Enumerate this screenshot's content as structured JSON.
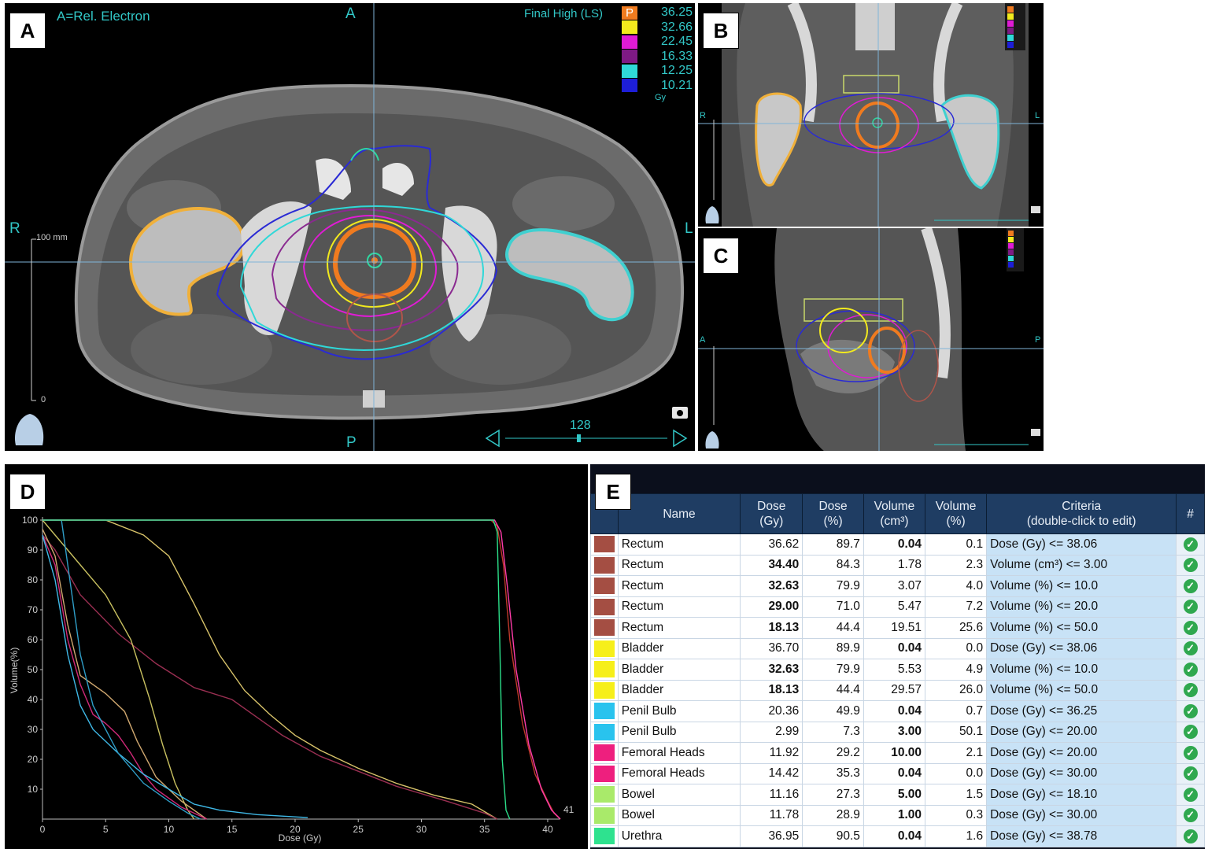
{
  "panels": {
    "a": {
      "label": "A",
      "title": "A=Rel. Electron",
      "orient": {
        "top": "A",
        "bottom": "P",
        "left": "R",
        "right": "L"
      },
      "scale_top": "100 mm",
      "scale_bottom": "0",
      "slice": "128",
      "legend_title": "Final High (LS)",
      "legend_unit": "Gy",
      "legend_badge": "P",
      "legend": [
        {
          "value": "36.25",
          "color": "#f07b1f"
        },
        {
          "value": "32.66",
          "color": "#f2ea1d"
        },
        {
          "value": "22.45",
          "color": "#e01bd5"
        },
        {
          "value": "16.33",
          "color": "#7e1a84"
        },
        {
          "value": "12.25",
          "color": "#2fd8d8"
        },
        {
          "value": "10.21",
          "color": "#1d1ed8"
        }
      ]
    },
    "b": {
      "label": "B",
      "orient_left": "R",
      "orient_right": "L"
    },
    "c": {
      "label": "C",
      "orient_left": "A",
      "orient_right": "P"
    },
    "d": {
      "label": "D"
    },
    "e": {
      "label": "E"
    }
  },
  "chart_data": {
    "type": "line",
    "xlabel": "Dose (Gy)",
    "ylabel": "Volume(%)",
    "xlim": [
      0,
      41
    ],
    "ylim": [
      0,
      100
    ],
    "x_ticks": [
      0,
      5,
      10,
      15,
      20,
      25,
      30,
      35,
      40
    ],
    "y_ticks": [
      10,
      20,
      30,
      40,
      50,
      60,
      70,
      80,
      90,
      100
    ],
    "annotation": "41",
    "series": [
      {
        "color": "#d8c36a",
        "points": [
          [
            0,
            100
          ],
          [
            5,
            100
          ],
          [
            8,
            95
          ],
          [
            10,
            88
          ],
          [
            12,
            72
          ],
          [
            14,
            55
          ],
          [
            16,
            43
          ],
          [
            18,
            35
          ],
          [
            20,
            28
          ],
          [
            22,
            23
          ],
          [
            25,
            17
          ],
          [
            28,
            12
          ],
          [
            31,
            8
          ],
          [
            34,
            5
          ],
          [
            36,
            0
          ]
        ]
      },
      {
        "color": "#9a2f52",
        "points": [
          [
            0,
            95
          ],
          [
            1,
            90
          ],
          [
            3,
            75
          ],
          [
            6,
            62
          ],
          [
            9,
            52
          ],
          [
            12,
            44
          ],
          [
            15,
            40
          ],
          [
            17,
            34
          ],
          [
            19,
            28
          ],
          [
            22,
            21
          ],
          [
            25,
            16
          ],
          [
            28,
            11
          ],
          [
            32,
            6
          ],
          [
            35,
            2
          ],
          [
            36,
            0
          ]
        ]
      },
      {
        "color": "#c8c060",
        "points": [
          [
            0,
            100
          ],
          [
            1,
            95
          ],
          [
            3,
            85
          ],
          [
            5,
            75
          ],
          [
            7,
            60
          ],
          [
            8.5,
            40
          ],
          [
            9.5,
            25
          ],
          [
            10.5,
            12
          ],
          [
            11.5,
            3
          ],
          [
            12,
            0
          ]
        ]
      },
      {
        "color": "#d0a870",
        "points": [
          [
            0,
            97
          ],
          [
            1,
            88
          ],
          [
            2,
            65
          ],
          [
            3,
            48
          ],
          [
            5,
            42
          ],
          [
            6.5,
            36
          ],
          [
            7.5,
            26
          ],
          [
            9,
            14
          ],
          [
            11,
            6
          ],
          [
            13,
            0
          ]
        ]
      },
      {
        "color": "#d02878",
        "points": [
          [
            0,
            95
          ],
          [
            1,
            85
          ],
          [
            2,
            60
          ],
          [
            3,
            45
          ],
          [
            4,
            35
          ],
          [
            5,
            32
          ],
          [
            6,
            28
          ],
          [
            7,
            22
          ],
          [
            8,
            15
          ],
          [
            9,
            10
          ],
          [
            11,
            4
          ],
          [
            13,
            0
          ]
        ]
      },
      {
        "color": "#3fb8e6",
        "points": [
          [
            0,
            95
          ],
          [
            1,
            80
          ],
          [
            2,
            55
          ],
          [
            3,
            38
          ],
          [
            4,
            30
          ],
          [
            6,
            22
          ],
          [
            8,
            15
          ],
          [
            10,
            10
          ],
          [
            12,
            5
          ],
          [
            14,
            3
          ],
          [
            17,
            1.5
          ],
          [
            21,
            0.5
          ]
        ]
      },
      {
        "color": "#2f9ec8",
        "points": [
          [
            0,
            100
          ],
          [
            1.5,
            100
          ],
          [
            2,
            85
          ],
          [
            3,
            55
          ],
          [
            4,
            38
          ],
          [
            6,
            22
          ],
          [
            8,
            12
          ],
          [
            10,
            6
          ],
          [
            11.5,
            2
          ],
          [
            12.5,
            0
          ]
        ]
      },
      {
        "color": "#c0392b",
        "points": [
          [
            0,
            100
          ],
          [
            35.5,
            100
          ],
          [
            36,
            98
          ],
          [
            36.5,
            85
          ],
          [
            37,
            60
          ],
          [
            38,
            32
          ],
          [
            39,
            15
          ],
          [
            40,
            6
          ],
          [
            40.5,
            2
          ],
          [
            41,
            0
          ]
        ]
      },
      {
        "color": "#ff3caa",
        "points": [
          [
            0,
            100
          ],
          [
            35.8,
            100
          ],
          [
            36.3,
            96
          ],
          [
            36.8,
            78
          ],
          [
            37.5,
            50
          ],
          [
            38.5,
            25
          ],
          [
            39.5,
            10
          ],
          [
            40.3,
            3
          ],
          [
            41,
            0
          ]
        ]
      },
      {
        "color": "#2ce08a",
        "points": [
          [
            0,
            100
          ],
          [
            35.7,
            100
          ],
          [
            36,
            96
          ],
          [
            36.2,
            60
          ],
          [
            36.4,
            20
          ],
          [
            36.7,
            3
          ],
          [
            37,
            0
          ]
        ]
      }
    ]
  },
  "table": {
    "headers": [
      "Name",
      "Dose\n(Gy)",
      "Dose\n(%)",
      "Volume\n(cm³)",
      "Volume\n(%)",
      "Criteria\n(double-click to edit)",
      "#"
    ],
    "rows": [
      {
        "color": "#a44e43",
        "name": "Rectum",
        "dose_gy": "36.62",
        "dose_pct": "89.7",
        "vol_cm3": "0.04",
        "vol_pct": "0.1",
        "criteria": "Dose (Gy) <= 38.06",
        "bold": "vol_cm3"
      },
      {
        "color": "#a44e43",
        "name": "Rectum",
        "dose_gy": "34.40",
        "dose_pct": "84.3",
        "vol_cm3": "1.78",
        "vol_pct": "2.3",
        "criteria": "Volume (cm³) <= 3.00",
        "bold": "dose_gy"
      },
      {
        "color": "#a44e43",
        "name": "Rectum",
        "dose_gy": "32.63",
        "dose_pct": "79.9",
        "vol_cm3": "3.07",
        "vol_pct": "4.0",
        "criteria": "Volume (%) <= 10.0",
        "bold": "dose_gy"
      },
      {
        "color": "#a44e43",
        "name": "Rectum",
        "dose_gy": "29.00",
        "dose_pct": "71.0",
        "vol_cm3": "5.47",
        "vol_pct": "7.2",
        "criteria": "Volume (%) <= 20.0",
        "bold": "dose_gy"
      },
      {
        "color": "#a44e43",
        "name": "Rectum",
        "dose_gy": "18.13",
        "dose_pct": "44.4",
        "vol_cm3": "19.51",
        "vol_pct": "25.6",
        "criteria": "Volume (%) <= 50.0",
        "bold": "dose_gy"
      },
      {
        "color": "#f6ef1a",
        "name": "Bladder",
        "dose_gy": "36.70",
        "dose_pct": "89.9",
        "vol_cm3": "0.04",
        "vol_pct": "0.0",
        "criteria": "Dose (Gy) <= 38.06",
        "bold": "vol_cm3"
      },
      {
        "color": "#f6ef1a",
        "name": "Bladder",
        "dose_gy": "32.63",
        "dose_pct": "79.9",
        "vol_cm3": "5.53",
        "vol_pct": "4.9",
        "criteria": "Volume (%) <= 10.0",
        "bold": "dose_gy"
      },
      {
        "color": "#f6ef1a",
        "name": "Bladder",
        "dose_gy": "18.13",
        "dose_pct": "44.4",
        "vol_cm3": "29.57",
        "vol_pct": "26.0",
        "criteria": "Volume (%) <= 50.0",
        "bold": "dose_gy"
      },
      {
        "color": "#29c3ee",
        "name": "Penil Bulb",
        "dose_gy": "20.36",
        "dose_pct": "49.9",
        "vol_cm3": "0.04",
        "vol_pct": "0.7",
        "criteria": "Dose (Gy) <= 36.25",
        "bold": "vol_cm3"
      },
      {
        "color": "#29c3ee",
        "name": "Penil Bulb",
        "dose_gy": "2.99",
        "dose_pct": "7.3",
        "vol_cm3": "3.00",
        "vol_pct": "50.1",
        "criteria": "Dose (Gy) <= 20.00",
        "bold": "vol_cm3"
      },
      {
        "color": "#ee1f7e",
        "name": "Femoral  Heads",
        "dose_gy": "11.92",
        "dose_pct": "29.2",
        "vol_cm3": "10.00",
        "vol_pct": "2.1",
        "criteria": "Dose (Gy) <= 20.00",
        "bold": "vol_cm3"
      },
      {
        "color": "#ee1f7e",
        "name": "Femoral  Heads",
        "dose_gy": "14.42",
        "dose_pct": "35.3",
        "vol_cm3": "0.04",
        "vol_pct": "0.0",
        "criteria": "Dose (Gy) <= 30.00",
        "bold": "vol_cm3"
      },
      {
        "color": "#a9ea6a",
        "name": "Bowel",
        "dose_gy": "11.16",
        "dose_pct": "27.3",
        "vol_cm3": "5.00",
        "vol_pct": "1.5",
        "criteria": "Dose (Gy) <= 18.10",
        "bold": "vol_cm3"
      },
      {
        "color": "#a9ea6a",
        "name": "Bowel",
        "dose_gy": "11.78",
        "dose_pct": "28.9",
        "vol_cm3": "1.00",
        "vol_pct": "0.3",
        "criteria": "Dose (Gy) <= 30.00",
        "bold": "vol_cm3"
      },
      {
        "color": "#2ee28f",
        "name": "Urethra",
        "dose_gy": "36.95",
        "dose_pct": "90.5",
        "vol_cm3": "0.04",
        "vol_pct": "1.6",
        "criteria": "Dose (Gy) <= 38.78",
        "bold": "vol_cm3"
      }
    ]
  }
}
